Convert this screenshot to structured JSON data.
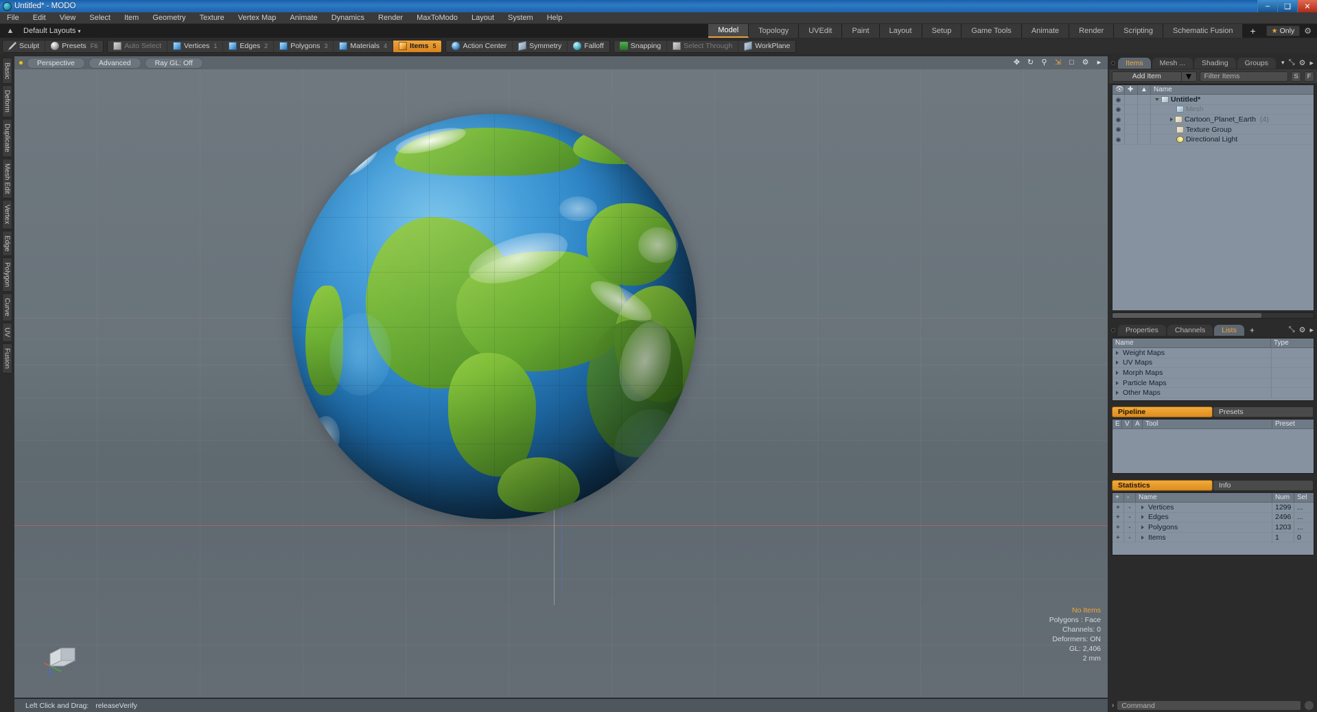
{
  "window": {
    "title": "Untitled* - MODO",
    "app_icon": "modo-orb-icon",
    "minimize": "–",
    "maximize": "❑",
    "close": "✕"
  },
  "menubar": {
    "items": [
      "File",
      "Edit",
      "View",
      "Select",
      "Item",
      "Geometry",
      "Texture",
      "Vertex Map",
      "Animate",
      "Dynamics",
      "Render",
      "MaxToModo",
      "Layout",
      "System",
      "Help"
    ]
  },
  "layoutbar": {
    "home_icon": "home-icon",
    "default_layouts": "Default Layouts",
    "caret": "▾",
    "tabs": [
      {
        "label": "Model",
        "active": true
      },
      {
        "label": "Topology",
        "active": false
      },
      {
        "label": "UVEdit",
        "active": false
      },
      {
        "label": "Paint",
        "active": false
      },
      {
        "label": "Layout",
        "active": false
      },
      {
        "label": "Setup",
        "active": false
      },
      {
        "label": "Game Tools",
        "active": false
      },
      {
        "label": "Animate",
        "active": false
      },
      {
        "label": "Render",
        "active": false
      },
      {
        "label": "Scripting",
        "active": false
      },
      {
        "label": "Schematic Fusion",
        "active": false
      }
    ],
    "add_tab": "+",
    "only_label": "Only",
    "only_star": "★",
    "gear": "⚙"
  },
  "toolbar": {
    "groups": [
      {
        "buttons": [
          {
            "label": "Sculpt",
            "icon": "pen-icon",
            "active": false,
            "dim": false,
            "num": ""
          },
          {
            "label": "Presets",
            "icon": "sphere-icon",
            "active": false,
            "dim": false,
            "num": "F6"
          }
        ]
      },
      {
        "buttons": [
          {
            "label": "Auto Select",
            "icon": "cube-gray-icon",
            "active": false,
            "dim": true,
            "num": ""
          },
          {
            "label": "Vertices",
            "icon": "cube-blue-icon",
            "active": false,
            "dim": false,
            "num": "1"
          },
          {
            "label": "Edges",
            "icon": "cube-blue-icon",
            "active": false,
            "dim": false,
            "num": "2"
          },
          {
            "label": "Polygons",
            "icon": "cube-blue-icon",
            "active": false,
            "dim": false,
            "num": "3"
          },
          {
            "label": "Materials",
            "icon": "cube-blue-icon",
            "active": false,
            "dim": false,
            "num": "4"
          },
          {
            "label": "Items",
            "icon": "cube-orange-icon",
            "active": true,
            "dim": false,
            "num": "5"
          }
        ]
      },
      {
        "buttons": [
          {
            "label": "Action Center",
            "icon": "circle-blue-icon",
            "active": false,
            "dim": false,
            "num": ""
          },
          {
            "label": "Symmetry",
            "icon": "plane-icon",
            "active": false,
            "dim": false,
            "num": ""
          },
          {
            "label": "Falloff",
            "icon": "circle-teal-icon",
            "active": false,
            "dim": false,
            "num": ""
          }
        ]
      },
      {
        "buttons": [
          {
            "label": "Snapping",
            "icon": "magnet-icon",
            "active": false,
            "dim": false,
            "num": ""
          },
          {
            "label": "Select Through",
            "icon": "cube-gray-icon",
            "active": false,
            "dim": true,
            "num": ""
          },
          {
            "label": "WorkPlane",
            "icon": "plane-icon",
            "active": false,
            "dim": false,
            "num": ""
          }
        ]
      }
    ]
  },
  "left_tabs": [
    "Basic",
    "Deform",
    "Duplicate",
    "Mesh Edit",
    "Vertex",
    "Edge",
    "Polygon",
    "Curve",
    "UV",
    "Fusion"
  ],
  "viewport": {
    "view_mode": "Perspective",
    "shading": "Advanced",
    "raygl": "Ray GL: Off",
    "nav_icons": [
      "pan-icon",
      "rotate-icon",
      "zoom-icon",
      "fit-icon",
      "maximize-icon",
      "gear-icon",
      "chevron-right-icon"
    ],
    "hud": {
      "selection": "No Items",
      "polygons": "Polygons : Face",
      "channels": "Channels: 0",
      "deformers": "Deformers: ON",
      "gl": "GL: 2,406",
      "grid": "2 mm"
    }
  },
  "items_panel": {
    "tabs": [
      {
        "label": "Items",
        "active": true
      },
      {
        "label": "Mesh ...",
        "active": false
      },
      {
        "label": "Shading",
        "active": false
      },
      {
        "label": "Groups",
        "active": false
      }
    ],
    "tab_caret": "▾",
    "tab_icons": [
      "expand-icon",
      "gear-icon",
      "chevron-right-icon"
    ],
    "add_item": "Add Item",
    "add_item_caret": "▾",
    "filter_placeholder": "Filter Items",
    "btn_s": "S",
    "btn_f": "F",
    "columns": {
      "eye": "eye-icon",
      "lock": "lock-icon",
      "render": "render-icon",
      "name": "Name"
    },
    "rows": [
      {
        "name": "Untitled*",
        "icon": "scene-icon",
        "indent": 0,
        "toggle": "down",
        "bold": true,
        "dim": false,
        "count": ""
      },
      {
        "name": "Mesh",
        "icon": "mesh-icon",
        "indent": 1,
        "toggle": "none",
        "bold": false,
        "dim": true,
        "count": ""
      },
      {
        "name": "Cartoon_Planet_Earth",
        "icon": "folder-icon",
        "indent": 1,
        "toggle": "right",
        "bold": false,
        "dim": false,
        "count": "(4)"
      },
      {
        "name": "Texture Group",
        "icon": "folder-icon",
        "indent": 1,
        "toggle": "none",
        "bold": false,
        "dim": false,
        "count": ""
      },
      {
        "name": "Directional Light",
        "icon": "light-icon",
        "indent": 1,
        "toggle": "none",
        "bold": false,
        "dim": false,
        "count": ""
      }
    ]
  },
  "lists_panel": {
    "tabs": [
      {
        "label": "Properties",
        "active": false
      },
      {
        "label": "Channels",
        "active": false
      },
      {
        "label": "Lists",
        "active": true
      }
    ],
    "plus": "+",
    "columns": {
      "name": "Name",
      "type": "Type"
    },
    "rows": [
      {
        "name": "Weight Maps",
        "type": ""
      },
      {
        "name": "UV Maps",
        "type": ""
      },
      {
        "name": "Morph Maps",
        "type": ""
      },
      {
        "name": "Particle Maps",
        "type": ""
      },
      {
        "name": "Other Maps",
        "type": ""
      }
    ]
  },
  "pipeline_panel": {
    "tabs": [
      {
        "label": "Pipeline",
        "active": true
      },
      {
        "label": "Presets",
        "active": false
      }
    ],
    "columns": {
      "e": "E",
      "v": "V",
      "a": "A",
      "tool": "Tool",
      "preset": "Preset"
    },
    "rows": []
  },
  "statistics_panel": {
    "tabs": [
      {
        "label": "Statistics",
        "active": true
      },
      {
        "label": "Info",
        "active": false
      }
    ],
    "columns": {
      "plus": "+",
      "minus": "-",
      "name": "Name",
      "num": "Num",
      "sel": "Sel"
    },
    "rows": [
      {
        "plus": "+",
        "minus": "-",
        "name": "Vertices",
        "num": "1299",
        "sel": "..."
      },
      {
        "plus": "+",
        "minus": "-",
        "name": "Edges",
        "num": "2496",
        "sel": "..."
      },
      {
        "plus": "+",
        "minus": "-",
        "name": "Polygons",
        "num": "1203",
        "sel": "..."
      },
      {
        "plus": "+",
        "minus": "-",
        "name": "Items",
        "num": "1",
        "sel": "0"
      }
    ]
  },
  "statusbar": {
    "hint_action": "Left Click and Drag:",
    "hint_value": "releaseVerify"
  },
  "command_line": {
    "chevron": "›",
    "placeholder": "Command",
    "run_icon": "run-icon"
  },
  "colors": {
    "accent_orange": "#f0a83c",
    "title_blue": "#2d7bc4",
    "panel_bg": "#2b2b2b",
    "list_bg": "#8792a0",
    "viewport_bg": "#646d75",
    "globe_ocean": "#2072b4",
    "globe_land": "#6eb133"
  }
}
